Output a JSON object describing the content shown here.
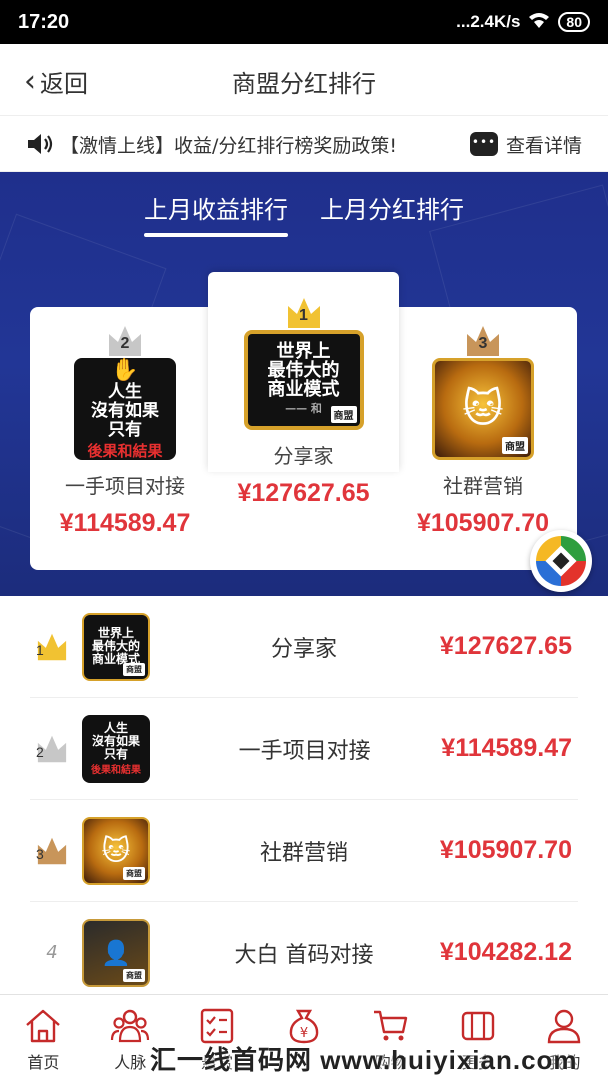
{
  "status_bar": {
    "time": "17:20",
    "network": "...2.4K/s",
    "battery": "80"
  },
  "header": {
    "back_label": "返回",
    "title": "商盟分红排行"
  },
  "notice": {
    "text": "【激情上线】收益/分红排行榜奖励政策!",
    "detail_label": "查看详情"
  },
  "tabs": [
    {
      "label": "上月收益排行",
      "active": true
    },
    {
      "label": "上月分红排行",
      "active": false
    }
  ],
  "podium": {
    "first": {
      "rank": "1",
      "name": "分享家",
      "amount": "¥127627.65",
      "avatar_lines": [
        "世界上",
        "最伟大的",
        "商业模式"
      ],
      "avatar_sub": "—— 和",
      "badge": "商盟"
    },
    "second": {
      "rank": "2",
      "name": "一手项目对接",
      "amount": "¥114589.47",
      "avatar_lines": [
        "人生",
        "沒有如果",
        "只有"
      ],
      "avatar_red": "後果和結果"
    },
    "third": {
      "rank": "3",
      "name": "社群营销",
      "amount": "¥105907.70",
      "badge": "商盟"
    }
  },
  "ranking": [
    {
      "rank": "1",
      "name": "分享家",
      "amount": "¥127627.65",
      "avatar_lines": [
        "世界上",
        "最伟大的",
        "商业模式"
      ],
      "badge": "商盟",
      "crown": "#f1c232"
    },
    {
      "rank": "2",
      "name": "一手项目对接",
      "amount": "¥114589.47",
      "avatar_lines": [
        "人生",
        "沒有如果",
        "只有"
      ],
      "avatar_red": "後果和結果",
      "crown": "#c7c7c7"
    },
    {
      "rank": "3",
      "name": "社群营销",
      "amount": "¥105907.70",
      "badge": "商盟",
      "crown": "#c8955a"
    },
    {
      "rank": "4",
      "name": "大白 首码对接",
      "amount": "¥104282.12",
      "badge": "商盟"
    }
  ],
  "tabbar": [
    {
      "label": "首页",
      "icon": "home-icon"
    },
    {
      "label": "人脉",
      "icon": "people-icon"
    },
    {
      "label": "悬赏",
      "icon": "task-icon"
    },
    {
      "label": "",
      "icon": "money-bag-icon"
    },
    {
      "label": "购物",
      "icon": "cart-icon"
    },
    {
      "label": "更多",
      "icon": "grid-icon"
    },
    {
      "label": "我的",
      "icon": "user-icon"
    }
  ],
  "watermark": "汇一线首码网 www.huiyixian.com",
  "colors": {
    "accent": "#e0353b",
    "hero_bg": "#223696",
    "gold": "#f1c232",
    "silver": "#c7c7c7",
    "bronze": "#c8955a"
  }
}
